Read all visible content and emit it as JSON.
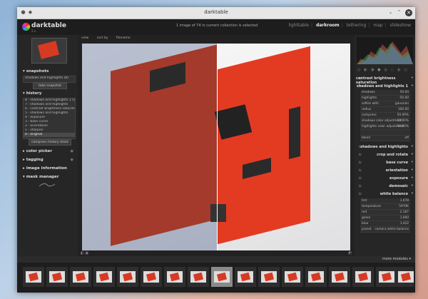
{
  "window": {
    "title": "darktable"
  },
  "header": {
    "logo": "darktable",
    "version": "2.x",
    "status": "1 image of 74 in current collection is selected",
    "views": [
      "lighttable",
      "darkroom",
      "tethering",
      "map",
      "slideshow"
    ],
    "active_view": "darkroom"
  },
  "center_toolbar": {
    "view": "view",
    "sort_by": "sort by",
    "filename": "filename"
  },
  "left": {
    "snapshots": {
      "title": "snapshots",
      "items": [
        "shadows and highlights (8)"
      ],
      "take_button": "take snapshot"
    },
    "history": {
      "title": "history",
      "items": [
        "8 - shadows and highlights 1 (off)",
        "7 - shadows and highlights",
        "6 - contrast brightness saturation",
        "5 - shadows and highlights",
        "4 - exposure",
        "3 - base curve",
        "2 - orientation",
        "1 - sharpen",
        "0 - original"
      ],
      "compress_button": "compress history stack"
    },
    "color_picker": "color picker",
    "tagging": "tagging",
    "image_information": "image information",
    "mask_manager": "mask manager"
  },
  "right": {
    "modules": [
      "contrast brightness saturation",
      "shadows and highlights 1",
      "shadows and highlights",
      "crop and rotate",
      "base curve",
      "orientation",
      "exposure",
      "demosaic",
      "white balance"
    ],
    "sh_params": [
      {
        "k": "shadows",
        "v": "50.00"
      },
      {
        "k": "highlights",
        "v": "-50.00"
      },
      {
        "k": "soften with",
        "v": "gaussian"
      },
      {
        "k": "radius",
        "v": "100.00"
      },
      {
        "k": "compress",
        "v": "50.00%"
      },
      {
        "k": "shadows color adjustment",
        "v": "50.00%"
      },
      {
        "k": "highlights color adjustment",
        "v": "50.00%"
      },
      {
        "k": "",
        "v": ""
      },
      {
        "k": "blend",
        "v": "off"
      }
    ],
    "wb_params": [
      {
        "k": "tint",
        "v": "1.078"
      },
      {
        "k": "temperature",
        "v": "5970K"
      },
      {
        "k": "red",
        "v": "2.187"
      },
      {
        "k": "green",
        "v": "1.000"
      },
      {
        "k": "blue",
        "v": "1.422"
      },
      {
        "k": "preset",
        "v": "camera white balance"
      }
    ],
    "more_modules": "more modules"
  },
  "colors": {
    "accent": "#e33b22",
    "panel": "#262626"
  }
}
